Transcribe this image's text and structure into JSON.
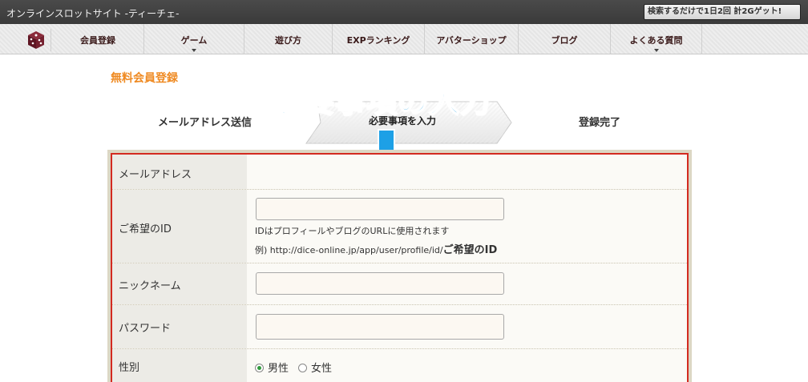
{
  "header": {
    "site_title": "オンラインスロットサイト -ティーチェ-",
    "search_promo": "検索するだけで1日2回 計2Gゲット!"
  },
  "nav": {
    "items": [
      {
        "label": "会員登録"
      },
      {
        "label": "ゲーム"
      },
      {
        "label": "遊び方"
      },
      {
        "label": "EXPランキング"
      },
      {
        "label": "アバターショップ"
      },
      {
        "label": "ブログ"
      },
      {
        "label": "よくある質問"
      }
    ]
  },
  "page": {
    "heading": "無料会員登録",
    "overlay_title": "必要事項の入力"
  },
  "steps": [
    {
      "label": "メールアドレス送信",
      "active": false
    },
    {
      "label": "必要事項を入力",
      "active": true
    },
    {
      "label": "登録完了",
      "active": false
    }
  ],
  "form": {
    "email": {
      "label": "メールアドレス",
      "value": ""
    },
    "user_id": {
      "label": "ご希望のID",
      "value": "",
      "hint1": "IDはプロフィールやブログのURLに使用されます",
      "hint2_prefix": "例) http://dice-online.jp/app/user/profile/id/",
      "hint2_emph": "ご希望のID"
    },
    "nickname": {
      "label": "ニックネーム",
      "value": ""
    },
    "password": {
      "label": "パスワード",
      "value": ""
    },
    "gender": {
      "label": "性別",
      "options": [
        {
          "label": "男性",
          "selected": true
        },
        {
          "label": "女性",
          "selected": false
        }
      ]
    }
  },
  "colors": {
    "accent_orange": "#ef8a22",
    "overlay_blue": "#1da0e6",
    "form_border": "#d32a20"
  }
}
